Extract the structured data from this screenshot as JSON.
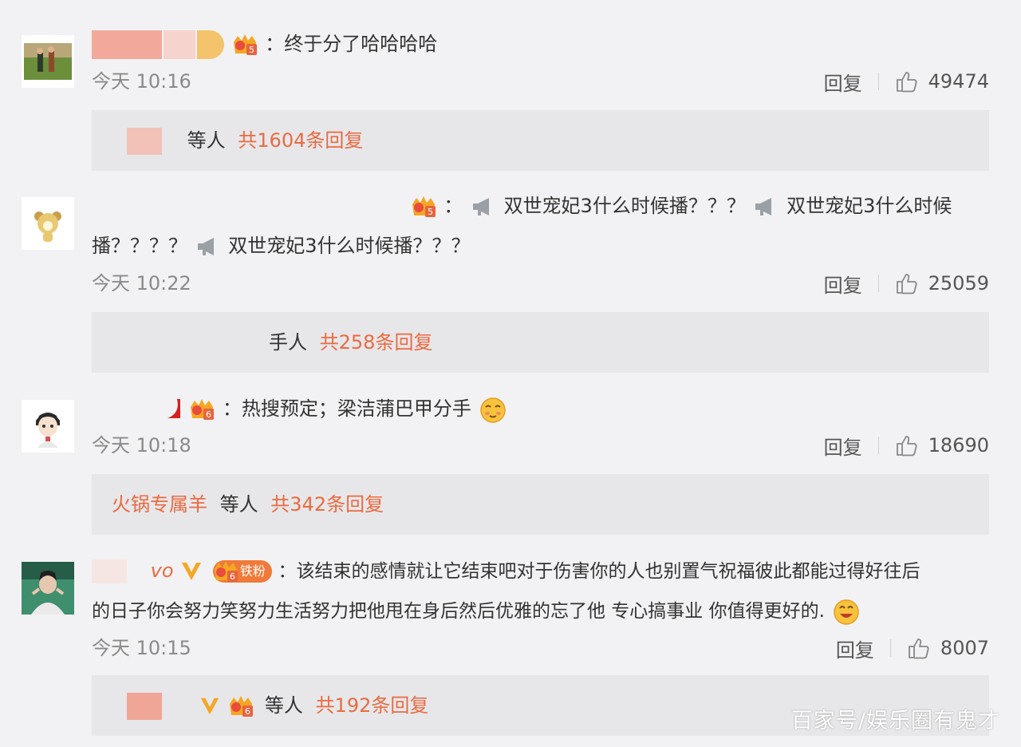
{
  "comments": [
    {
      "line1": "：终于分了哈哈哈哈",
      "time": "今天 10:16",
      "reply_label": "回复",
      "likes": "49474",
      "sub_prefix": "",
      "sub_mid": "等人",
      "sub_count": "共1604条回复"
    },
    {
      "line1_prefix": "：",
      "seg_a": "双世宠妃3什么时候播？？？",
      "seg_b": "双世宠妃3什么时候",
      "line2_a": "播？？？？",
      "seg_c": "双世宠妃3什么时候播？？？",
      "time": "今天 10:22",
      "reply_label": "回复",
      "likes": "25059",
      "sub_mid": "等人",
      "sub_mid_partial": "手人",
      "sub_count": "共258条回复"
    },
    {
      "line1": "：热搜预定；梁洁蒲巴甲分手",
      "time": "今天 10:18",
      "reply_label": "回复",
      "likes": "18690",
      "sub_user": "火锅专属羊",
      "sub_mid": "等人",
      "sub_count": "共342条回复"
    },
    {
      "name_fragment": "vo",
      "badge_label": "铁粉",
      "line1": "：该结束的感情就让它结束吧对于伤害你的人也别置气祝福彼此都能过得好往后",
      "line2": "的日子你会努力笑努力生活努力把他甩在身后然后优雅的忘了他 专心搞事业 你值得更好的.",
      "time": "今天 10:15",
      "reply_label": "回复",
      "likes": "8007",
      "sub_mid": "等人",
      "sub_count": "共192条回复"
    }
  ],
  "crown_levels": [
    "5",
    "5",
    "6",
    "6",
    "6"
  ],
  "watermark": "百家号/娱乐圈有鬼才",
  "colors": {
    "background": "#f2f2f4",
    "subbox": "#e7e7ea",
    "accent_orange": "#ec6a3f",
    "redaction_pink": "#f2b8ae"
  }
}
